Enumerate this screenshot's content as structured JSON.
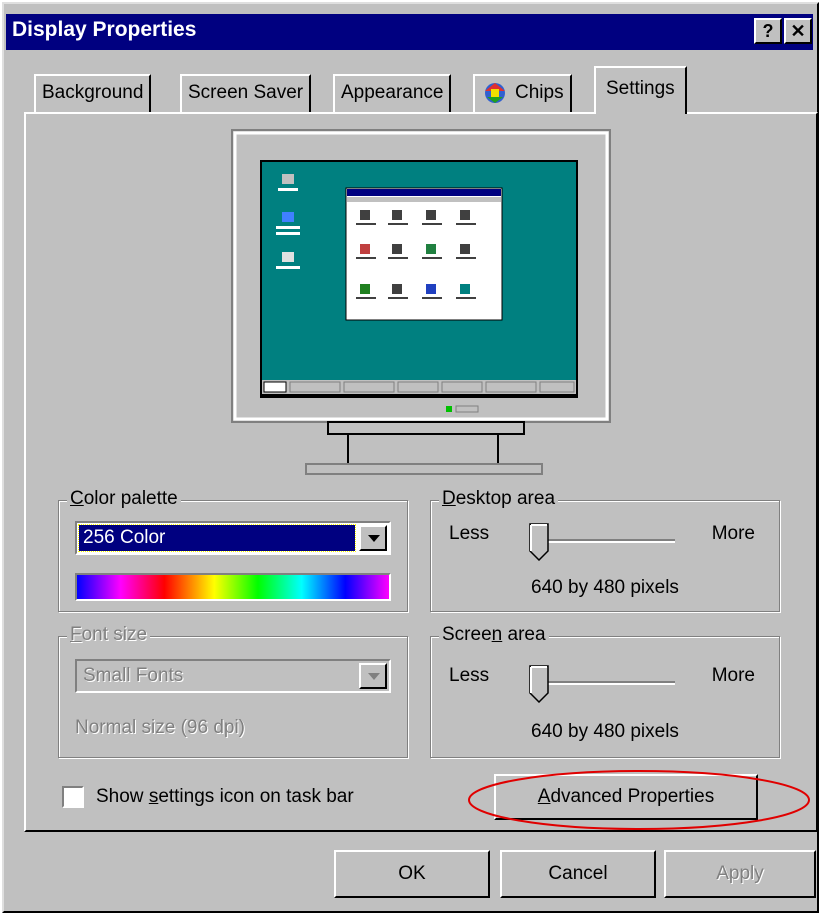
{
  "window": {
    "title": "Display Properties",
    "help_label": "?",
    "close_label": "✕"
  },
  "tabs": [
    {
      "label": "Background"
    },
    {
      "label": "Screen Saver"
    },
    {
      "label": "Appearance"
    },
    {
      "label": "Chips",
      "icon": "chips-icon"
    },
    {
      "label": "Settings",
      "active": true
    }
  ],
  "color_palette": {
    "legend_mnemonic": "C",
    "legend_rest": "olor palette",
    "selected": "256 Color"
  },
  "font_size": {
    "legend_mnemonic": "F",
    "legend_rest": "ont size",
    "selected": "Small Fonts",
    "description": "Normal size (96 dpi)"
  },
  "desktop_area": {
    "legend_mnemonic": "D",
    "legend_rest": "esktop area",
    "less_label": "Less",
    "more_label": "More",
    "level": 0,
    "value_text": "640 by 480 pixels"
  },
  "screen_area": {
    "legend_pre": "Scree",
    "legend_mnemonic": "n",
    "legend_rest": " area",
    "less_label": "Less",
    "more_label": "More",
    "level": 0,
    "value_text": "640 by 480 pixels"
  },
  "taskbar_checkbox": {
    "label_pre": "Show ",
    "label_mnemonic": "s",
    "label_rest": "ettings icon on task bar",
    "checked": false
  },
  "advanced_button": {
    "label_mnemonic": "A",
    "label_rest": "dvanced Properties",
    "highlight_color": "#e00000"
  },
  "buttons": {
    "ok": "OK",
    "cancel": "Cancel",
    "apply": "Apply"
  },
  "colors": {
    "titlebar": "#000080",
    "face": "#c0c0c0",
    "desktop": "#008080"
  }
}
